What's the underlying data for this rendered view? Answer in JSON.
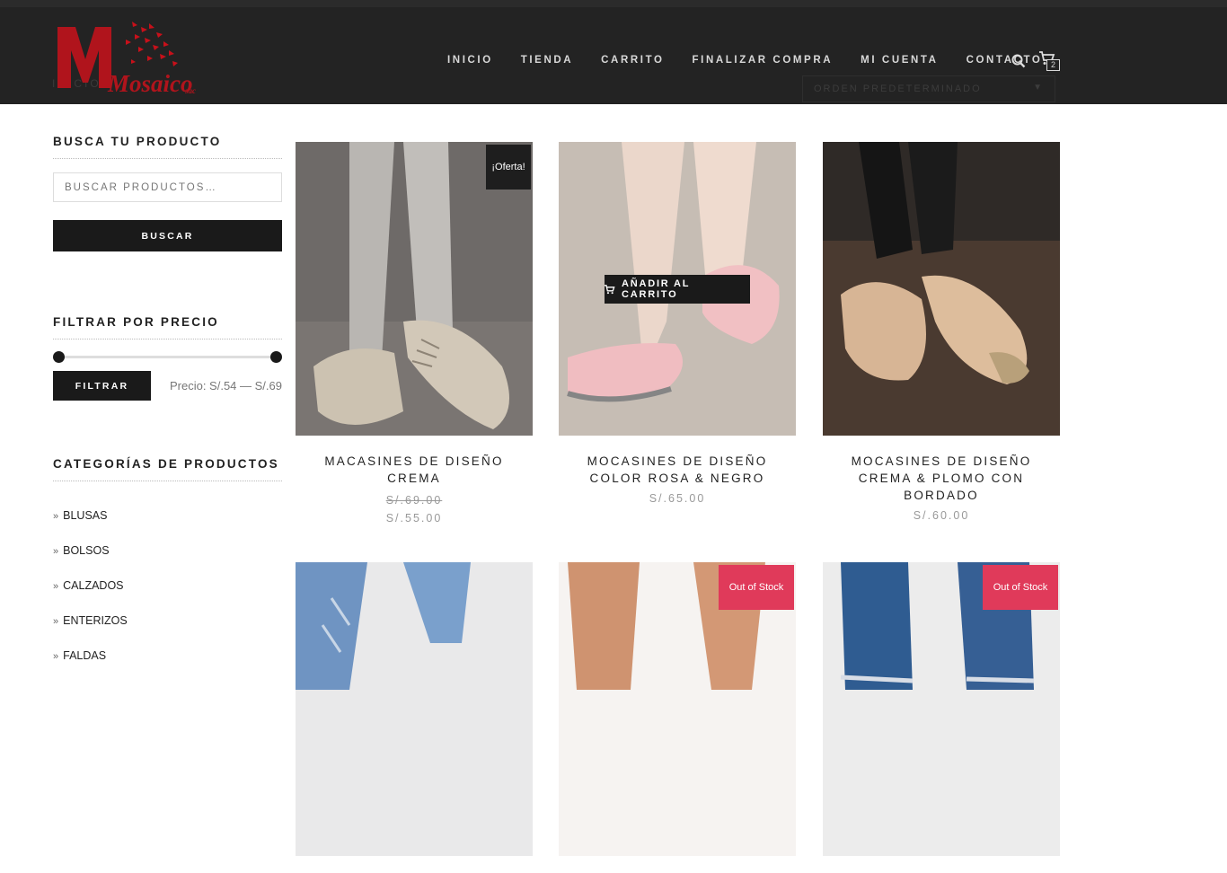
{
  "header": {
    "logo_text": "Mosaico",
    "logo_suffix": "sac",
    "ghost_label": "INICIO",
    "ghost_sort": "ORDEN PREDETERMINADO",
    "nav": [
      "INICIO",
      "TIENDA",
      "CARRITO",
      "FINALIZAR COMPRA",
      "MI CUENTA",
      "CONTACTO"
    ],
    "cart_count": "2",
    "icons": {
      "search": "search-icon",
      "cart": "cart-icon"
    }
  },
  "sidebar": {
    "search_title": "BUSCA TU PRODUCTO",
    "search_placeholder": "BUSCAR PRODUCTOS…",
    "search_button": "BUSCAR",
    "price_title": "FILTRAR POR PRECIO",
    "filter_button": "FILTRAR",
    "price_range": "Precio: S/.54 — S/.69",
    "categories_title": "CATEGORÍAS DE PRODUCTOS",
    "categories": [
      "BLUSAS",
      "BOLSOS",
      "CALZADOS",
      "ENTERIZOS",
      "FALDAS"
    ]
  },
  "products": [
    {
      "title": "MACASINES DE DISEÑO CREMA",
      "old_price": "S/.69.00",
      "price": "S/.55.00",
      "badge": "¡Oferta!"
    },
    {
      "title": "MOCASINES DE DISEÑO COLOR ROSA & NEGRO",
      "price": "S/.65.00",
      "add_to_cart": "AÑADIR AL CARRITO"
    },
    {
      "title": "MOCASINES DE DISEÑO CREMA & PLOMO CON BORDADO",
      "price": "S/.60.00"
    },
    {
      "title": ""
    },
    {
      "badge": "Out of Stock"
    },
    {
      "badge": "Out of Stock"
    }
  ],
  "colors": {
    "header_bg": "#232323",
    "dark_button": "#1a1a1a",
    "out_of_stock": "#e03a5a",
    "logo_red": "#b0141c"
  }
}
